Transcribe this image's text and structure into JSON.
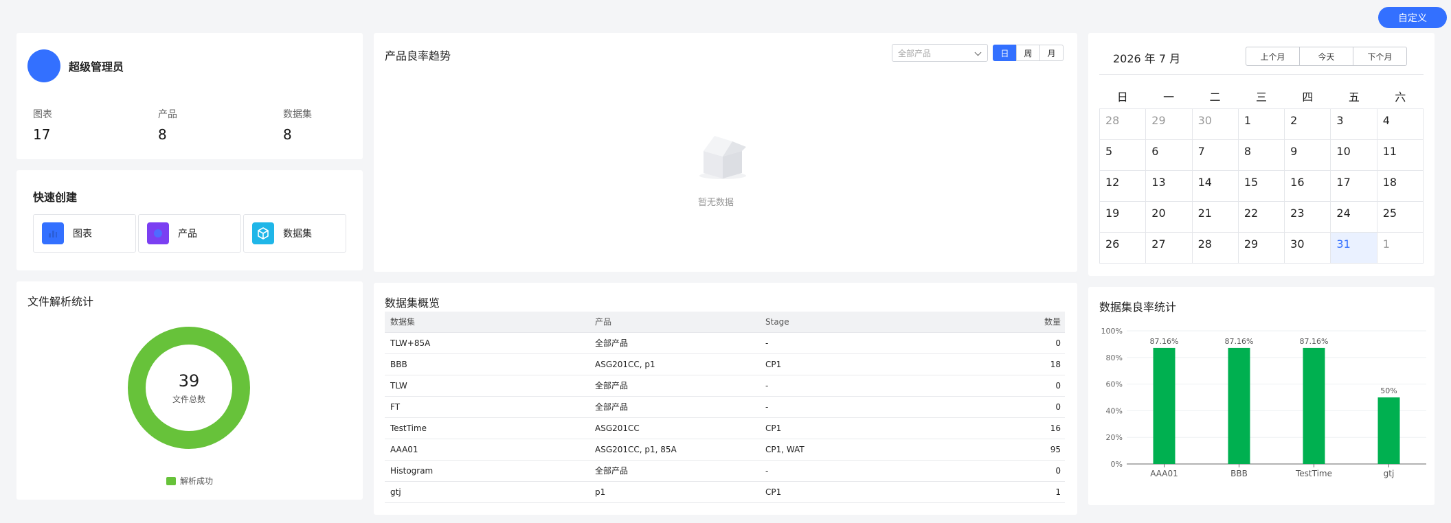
{
  "header": {
    "customize_label": "自定义"
  },
  "user": {
    "name": "超级管理员",
    "stats": [
      {
        "label": "图表",
        "value": "17"
      },
      {
        "label": "产品",
        "value": "8"
      },
      {
        "label": "数据集",
        "value": "8"
      }
    ]
  },
  "quick_create": {
    "title": "快速创建",
    "items": [
      {
        "label": "图表",
        "icon": "chart-icon",
        "color": "#3370ff"
      },
      {
        "label": "产品",
        "icon": "product-icon",
        "color": "#7b3ff2"
      },
      {
        "label": "数据集",
        "icon": "dataset-cube-icon",
        "color": "#1fb6e8"
      }
    ]
  },
  "file_stats": {
    "title": "文件解析统计",
    "total": "39",
    "total_label": "文件总数",
    "legend": "解析成功",
    "success_color": "#67c23a"
  },
  "trend": {
    "title": "产品良率趋势",
    "select_placeholder": "全部产品",
    "granularity": [
      "日",
      "周",
      "月"
    ],
    "active_granularity": "日",
    "empty_text": "暂无数据"
  },
  "dataset_overview": {
    "title": "数据集概览",
    "columns": [
      "数据集",
      "产品",
      "Stage",
      "数量"
    ],
    "rows": [
      [
        "TLW+85A",
        "全部产品",
        "-",
        "0"
      ],
      [
        "BBB",
        "ASG201CC, p1",
        "CP1",
        "18"
      ],
      [
        "TLW",
        "全部产品",
        "-",
        "0"
      ],
      [
        "FT",
        "全部产品",
        "-",
        "0"
      ],
      [
        "TestTime",
        "ASG201CC",
        "CP1",
        "16"
      ],
      [
        "AAA01",
        "ASG201CC, p1, 85A",
        "CP1, WAT",
        "95"
      ],
      [
        "Histogram",
        "全部产品",
        "-",
        "0"
      ],
      [
        "gtj",
        "p1",
        "CP1",
        "1"
      ]
    ]
  },
  "calendar": {
    "title": "2026 年 7 月",
    "nav": [
      "上个月",
      "今天",
      "下个月"
    ],
    "weekdays": [
      "日",
      "一",
      "二",
      "三",
      "四",
      "五",
      "六"
    ],
    "days": [
      {
        "d": "28",
        "m": true
      },
      {
        "d": "29",
        "m": true
      },
      {
        "d": "30",
        "m": true
      },
      {
        "d": "1"
      },
      {
        "d": "2"
      },
      {
        "d": "3"
      },
      {
        "d": "4"
      },
      {
        "d": "5"
      },
      {
        "d": "6"
      },
      {
        "d": "7"
      },
      {
        "d": "8"
      },
      {
        "d": "9"
      },
      {
        "d": "10"
      },
      {
        "d": "11"
      },
      {
        "d": "12"
      },
      {
        "d": "13"
      },
      {
        "d": "14"
      },
      {
        "d": "15"
      },
      {
        "d": "16"
      },
      {
        "d": "17"
      },
      {
        "d": "18"
      },
      {
        "d": "19"
      },
      {
        "d": "20"
      },
      {
        "d": "21"
      },
      {
        "d": "22"
      },
      {
        "d": "23"
      },
      {
        "d": "24"
      },
      {
        "d": "25"
      },
      {
        "d": "26"
      },
      {
        "d": "27"
      },
      {
        "d": "28"
      },
      {
        "d": "29"
      },
      {
        "d": "30"
      },
      {
        "d": "31",
        "today": true
      },
      {
        "d": "1",
        "m": true
      }
    ]
  },
  "yield_stats": {
    "title": "数据集良率统计"
  },
  "chart_data": {
    "type": "bar",
    "categories": [
      "AAA01",
      "BBB",
      "TestTime",
      "gtj"
    ],
    "values": [
      87.16,
      87.16,
      87.16,
      50
    ],
    "value_labels": [
      "87.16%",
      "87.16%",
      "87.16%",
      "50%"
    ],
    "yticks": [
      "0%",
      "20%",
      "40%",
      "60%",
      "80%",
      "100%"
    ],
    "ylim": [
      0,
      100
    ],
    "bar_color": "#00b050",
    "grid": true
  }
}
